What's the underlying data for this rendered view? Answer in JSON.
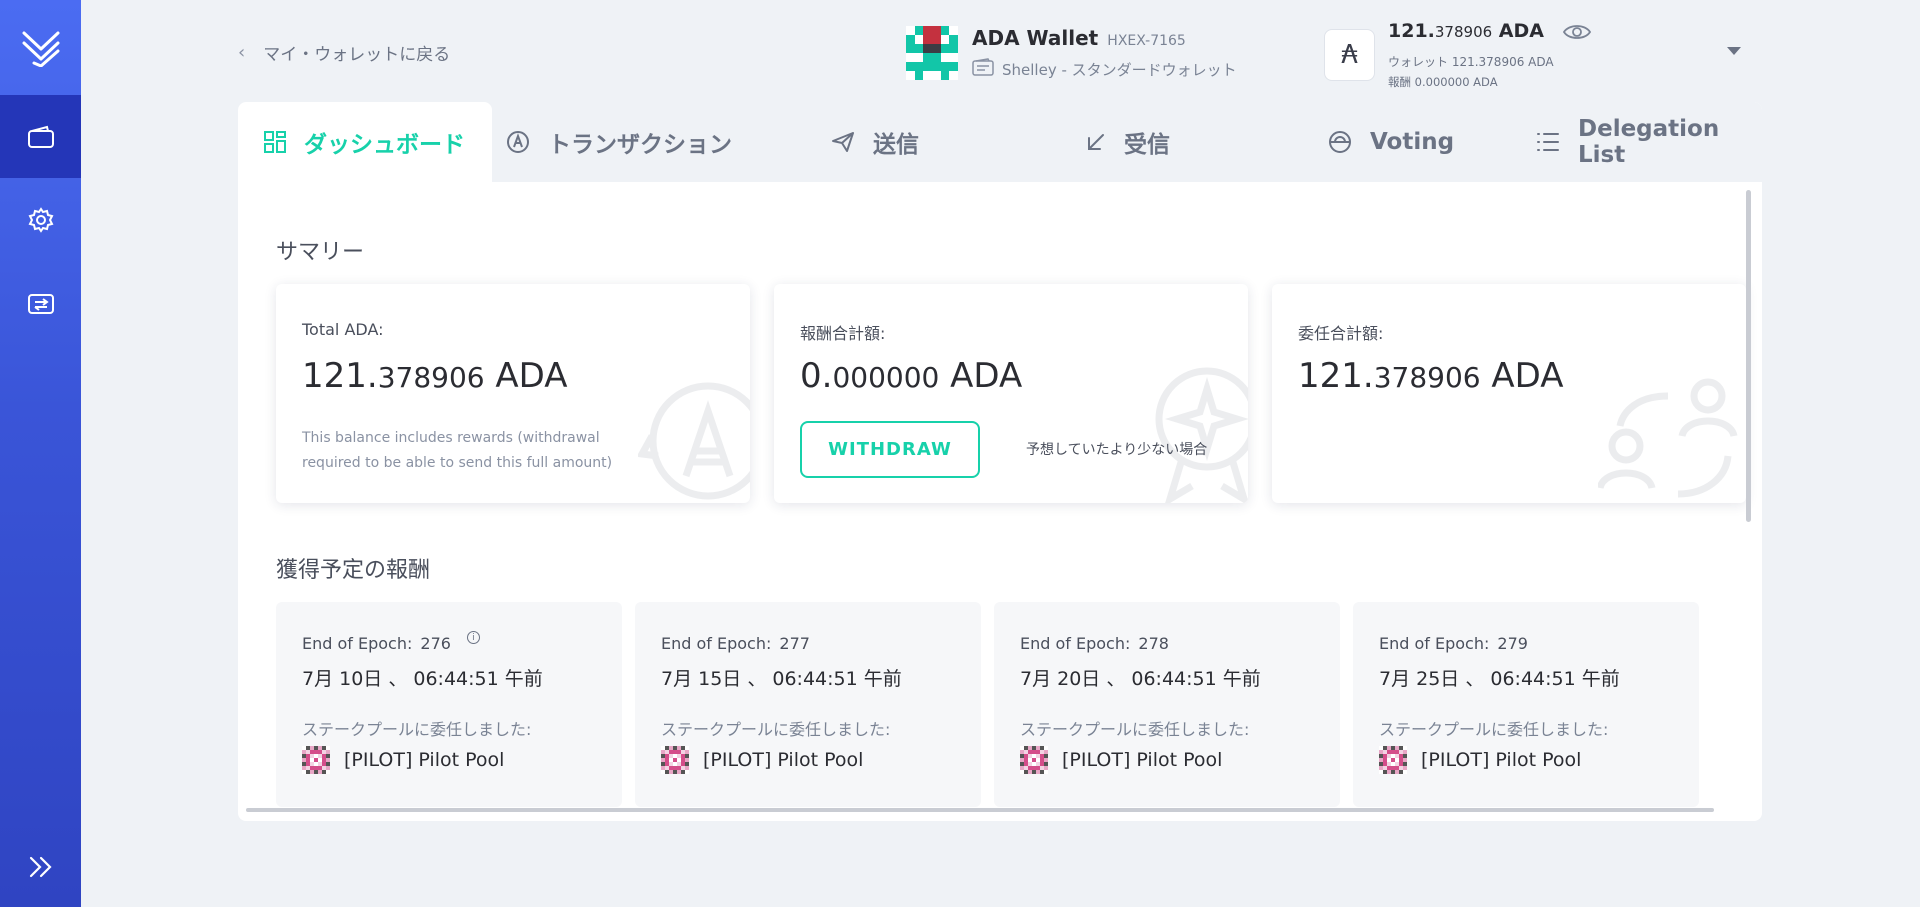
{
  "sidebar": {
    "logo_icon": "yoroi-logo-icon",
    "items": [
      {
        "icon": "wallet-icon",
        "active": true
      },
      {
        "icon": "gear-icon",
        "active": false
      },
      {
        "icon": "transfer-icon",
        "active": false
      }
    ],
    "expand_icon": "double-chevron-right-icon"
  },
  "header": {
    "back_label": "マイ・ウォレットに戻る",
    "wallet_name": "ADA Wallet",
    "wallet_plate": "HXEX-7165",
    "wallet_type": "Shelley - スタンダードウォレット",
    "balance_int": "121.",
    "balance_dec": "378906",
    "balance_unit": "ADA",
    "wallet_balance_line": "ウォレット 121.378906 ADA",
    "reward_line": "報酬 0.000000 ADA"
  },
  "tabs": [
    {
      "label": "ダッシュボード",
      "icon": "dashboard-icon",
      "active": true
    },
    {
      "label": "トランザクション",
      "icon": "transactions-icon",
      "active": false
    },
    {
      "label": "送信",
      "icon": "send-icon",
      "active": false
    },
    {
      "label": "受信",
      "icon": "receive-icon",
      "active": false
    },
    {
      "label": "Voting",
      "icon": "voting-icon",
      "active": false
    },
    {
      "label": "Delegation List",
      "icon": "list-icon",
      "active": false
    }
  ],
  "summary": {
    "title": "サマリー",
    "total": {
      "label": "Total ADA:",
      "amount_int": "121.",
      "amount_dec": "378906",
      "unit": " ADA",
      "note": "This balance includes rewards (withdrawal required to be able to send this full amount)"
    },
    "rewards": {
      "label": "報酬合計額:",
      "amount_int": "0.",
      "amount_dec": "000000",
      "unit": " ADA",
      "withdraw_label": "WITHDRAW",
      "less_than_expected": "予想していたより少ない場合"
    },
    "delegated": {
      "label": "委任合計額:",
      "amount_int": "121.",
      "amount_dec": "378906",
      "unit": " ADA"
    }
  },
  "upcoming": {
    "title": "獲得予定の報酬",
    "epochs": [
      {
        "label": "End of Epoch:",
        "epoch": "276",
        "date": "7月 10日 、 06:44:51 午前",
        "delegated_label": "ステークプールに委任しました:",
        "pool": "[PILOT] Pilot Pool",
        "info": "i"
      },
      {
        "label": "End of Epoch:",
        "epoch": "277",
        "date": "7月 15日 、 06:44:51 午前",
        "delegated_label": "ステークプールに委任しました:",
        "pool": "[PILOT] Pilot Pool"
      },
      {
        "label": "End of Epoch:",
        "epoch": "278",
        "date": "7月 20日 、 06:44:51 午前",
        "delegated_label": "ステークプールに委任しました:",
        "pool": "[PILOT] Pilot Pool"
      },
      {
        "label": "End of Epoch:",
        "epoch": "279",
        "date": "7月 25日 、 06:44:51 午前",
        "delegated_label": "ステークプールに委任しました:",
        "pool": "[PILOT] Pilot Pool"
      }
    ]
  },
  "colors": {
    "accent": "#17d1aa",
    "sidebar_top": "#4b6cf2",
    "sidebar_bottom": "#2f44c2",
    "sidebar_active": "#2436b8",
    "pool_pink": "#d44d8a"
  }
}
